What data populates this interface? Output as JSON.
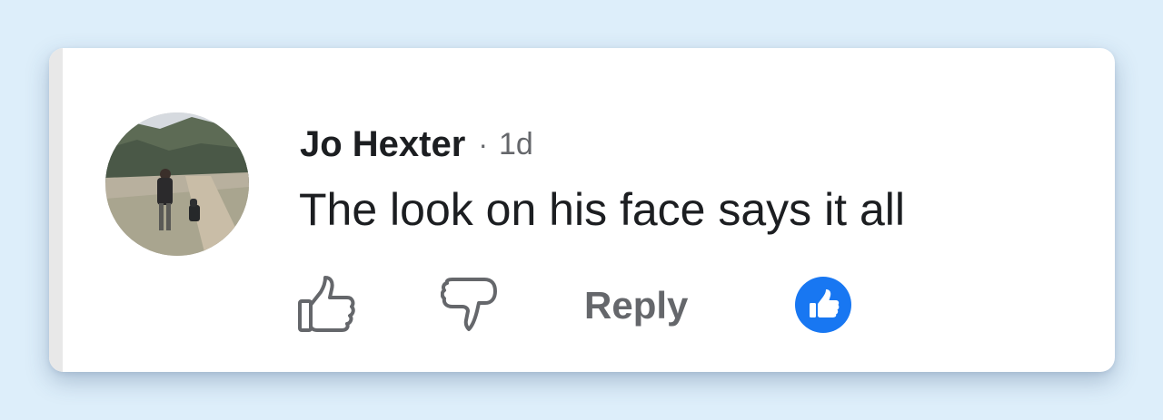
{
  "comment": {
    "author": "Jo Hexter",
    "separator": "·",
    "timestamp": "1d",
    "text": "The look on his face says it all"
  },
  "actions": {
    "like_icon": "thumbs-up-outline-icon",
    "dislike_icon": "thumbs-down-outline-icon",
    "reply_label": "Reply",
    "reaction_icon": "like-reaction-icon"
  },
  "colors": {
    "background": "#ddeefa",
    "text_primary": "#1c1e21",
    "text_secondary": "#65676b",
    "reaction_blue": "#1877f2"
  }
}
